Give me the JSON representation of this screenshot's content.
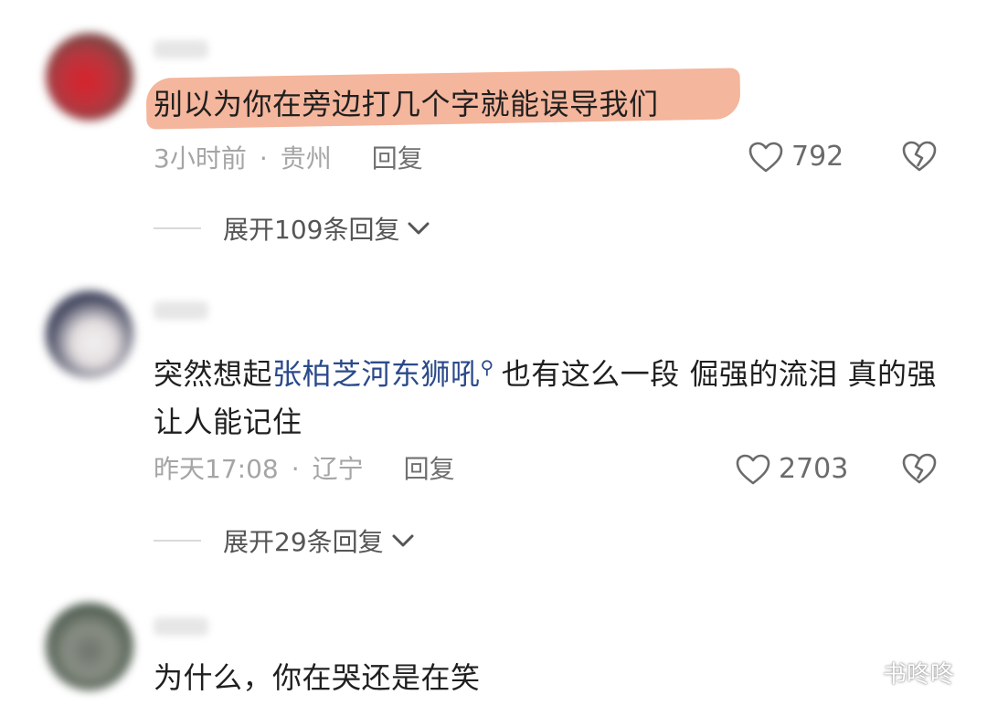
{
  "comments": [
    {
      "text": "别以为你在旁边打几个字就能误导我们",
      "time": "3小时前",
      "dot": "·",
      "location": "贵州",
      "reply": "回复",
      "likes": "792",
      "expand": "展开109条回复"
    },
    {
      "text_before": "突然想起",
      "link": "张柏芝河东狮吼",
      "text_after": "也有这么一段 倔强的流泪 真的强 让人能记住",
      "time": "昨天17:08",
      "dot": "·",
      "location": "辽宁",
      "reply": "回复",
      "likes": "2703",
      "expand": "展开29条回复"
    },
    {
      "text": "为什么，你在哭还是在笑"
    }
  ],
  "watermark": {
    "text": "书咚咚"
  },
  "colors": {
    "highlight": "#f2a98b",
    "link": "#2b4a8b",
    "meta": "#a5a5a5"
  }
}
